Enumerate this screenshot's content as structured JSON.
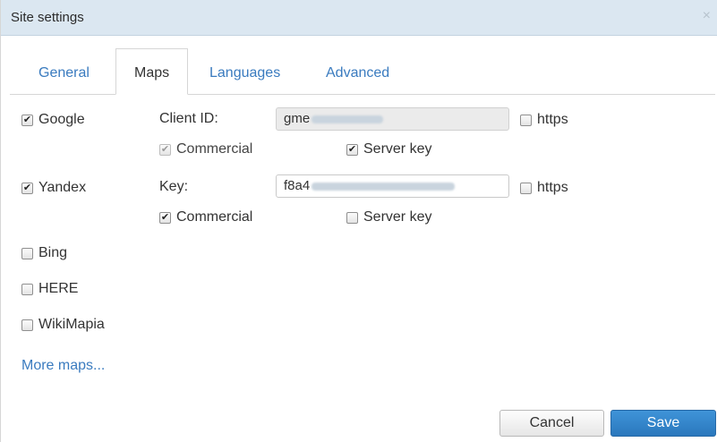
{
  "dialog": {
    "title": "Site settings",
    "close_glyph": "×"
  },
  "tabs": [
    {
      "label": "General",
      "active": false
    },
    {
      "label": "Maps",
      "active": true
    },
    {
      "label": "Languages",
      "active": false
    },
    {
      "label": "Advanced",
      "active": false
    }
  ],
  "providers": {
    "google": {
      "label": "Google",
      "checked": true,
      "field_label": "Client ID:",
      "field_value": "gme",
      "field_disabled": true,
      "https_label": "https",
      "https_checked": false,
      "commercial_label": "Commercial",
      "commercial_checked": true,
      "commercial_disabled": true,
      "server_key_label": "Server key",
      "server_key_checked": true
    },
    "yandex": {
      "label": "Yandex",
      "checked": true,
      "field_label": "Key:",
      "field_value": "f8a4",
      "field_disabled": false,
      "https_label": "https",
      "https_checked": false,
      "commercial_label": "Commercial",
      "commercial_checked": true,
      "server_key_label": "Server key",
      "server_key_checked": false
    },
    "bing": {
      "label": "Bing",
      "checked": false
    },
    "here": {
      "label": "HERE",
      "checked": false
    },
    "wikimapia": {
      "label": "WikiMapia",
      "checked": false
    }
  },
  "more_maps_link": "More maps...",
  "footer": {
    "cancel_label": "Cancel",
    "save_label": "Save"
  },
  "icons": {
    "check_glyph": "✔"
  },
  "colors": {
    "titlebar": "#dbe7f1",
    "link": "#3a7bbf",
    "primary_button": "#2f82c8"
  }
}
